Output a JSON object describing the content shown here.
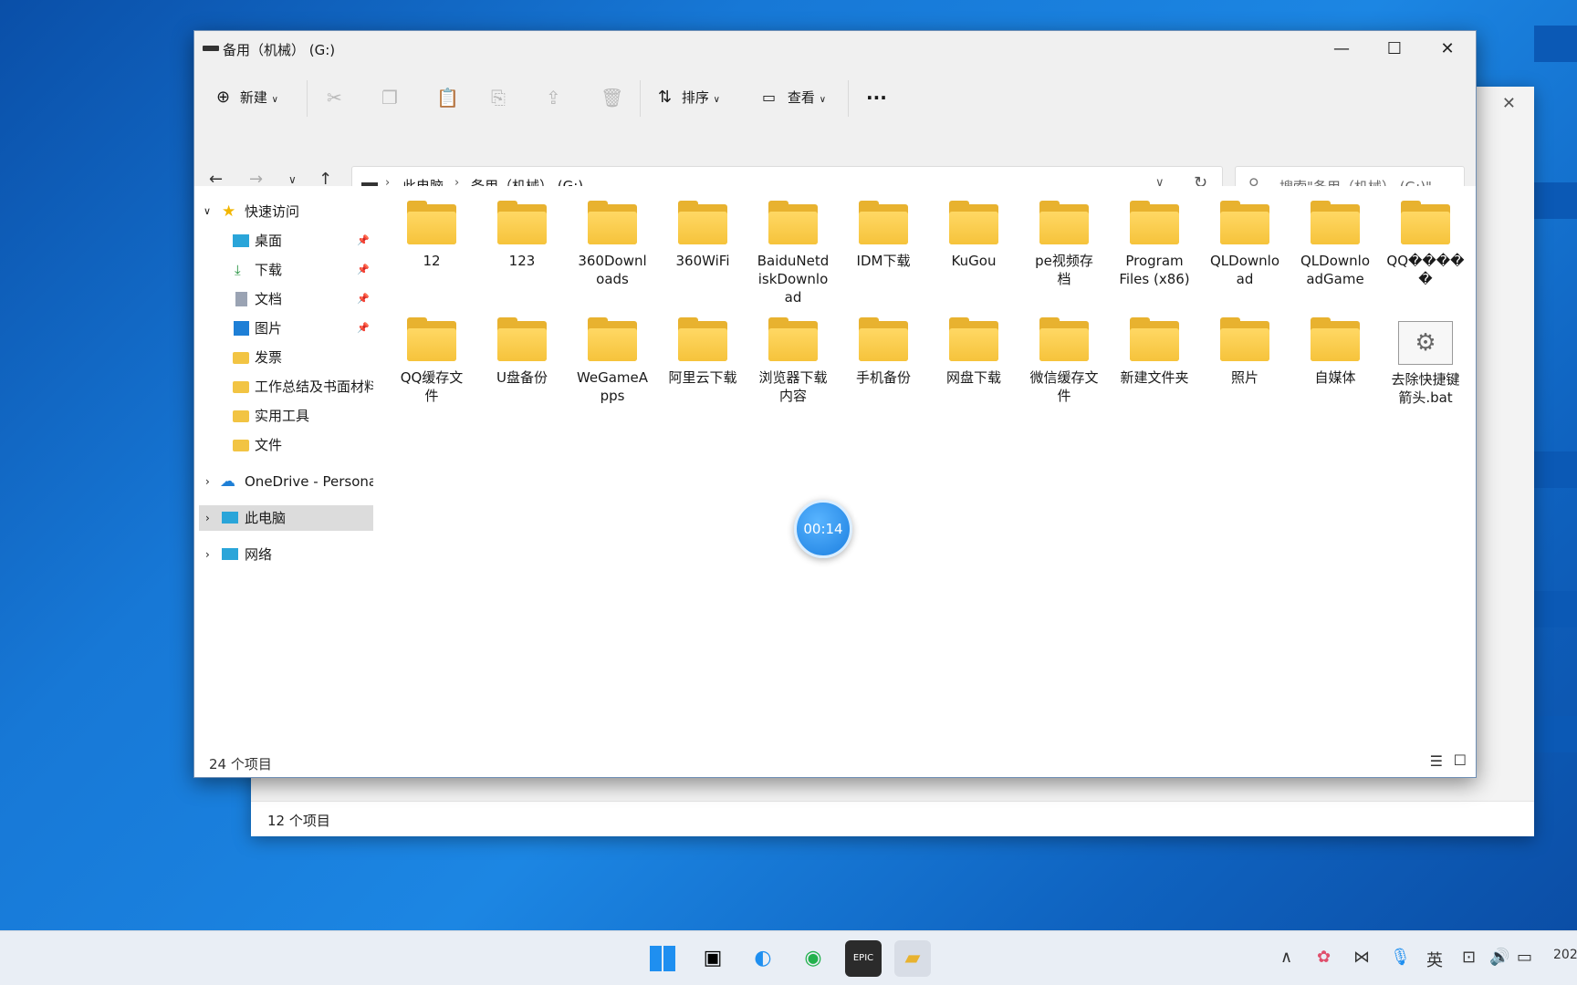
{
  "window": {
    "title": "备用（机械） (G:)",
    "min": "—",
    "max": "☐",
    "close": "✕"
  },
  "toolbar": {
    "new_label": "新建",
    "sort_label": "排序",
    "view_label": "查看",
    "more_label": "···"
  },
  "address": {
    "crumb1": "此电脑",
    "crumb2": "备用（机械） (G:)",
    "search_placeholder": "搜索\"备用（机械） (G:)\""
  },
  "sidebar": {
    "quick_access": "快速访问",
    "items": [
      {
        "label": "桌面",
        "pinned": true
      },
      {
        "label": "下载",
        "pinned": true
      },
      {
        "label": "文档",
        "pinned": true
      },
      {
        "label": "图片",
        "pinned": true
      },
      {
        "label": "发票",
        "pinned": false
      },
      {
        "label": "工作总结及书面材料",
        "pinned": false
      },
      {
        "label": "实用工具",
        "pinned": false
      },
      {
        "label": "文件",
        "pinned": false
      }
    ],
    "onedrive": "OneDrive - Personal",
    "this_pc": "此电脑",
    "network": "网络"
  },
  "files": [
    "12",
    "123",
    "360Downloads",
    "360WiFi",
    "BaiduNetdiskDownload",
    "IDM下载",
    "KuGou",
    "pe视频存档",
    "Program Files (x86)",
    "QLDownload",
    "QLDownloadGame",
    "QQ����",
    "QQ缓存文件",
    "U盘备份",
    "WeGameApps",
    "阿里云下载",
    "浏览器下载内容",
    "手机备份",
    "网盘下载",
    "微信缓存文件",
    "新建文件夹",
    "照片",
    "自媒体",
    "去除快捷键箭头.bat"
  ],
  "file_lines": [
    [
      "12"
    ],
    [
      "123"
    ],
    [
      "360Downl",
      "oads"
    ],
    [
      "360WiFi"
    ],
    [
      "BaiduNetd",
      "iskDownlo",
      "ad"
    ],
    [
      "IDM下载"
    ],
    [
      "KuGou"
    ],
    [
      "pe视频存",
      "档"
    ],
    [
      "Program",
      "Files (x86)"
    ],
    [
      "QLDownlo",
      "ad"
    ],
    [
      "QLDownlo",
      "adGame"
    ],
    [
      "QQ����",
      "�"
    ],
    [
      "QQ缓存文",
      "件"
    ],
    [
      "U盘备份"
    ],
    [
      "WeGameA",
      "pps"
    ],
    [
      "阿里云下载"
    ],
    [
      "浏览器下载",
      "内容"
    ],
    [
      "手机备份"
    ],
    [
      "网盘下载"
    ],
    [
      "微信缓存文",
      "件"
    ],
    [
      "新建文件夹"
    ],
    [
      "照片"
    ],
    [
      "自媒体"
    ],
    [
      "去除快捷键",
      "箭头.bat"
    ]
  ],
  "status": {
    "count": "24 个项目",
    "bg_count": "12 个项目"
  },
  "timer": "00:14",
  "taskbar": {
    "ime": "英",
    "clock_partial": "202"
  },
  "colors": {
    "desktop": "#1c86e3",
    "folder": "#f6c33b",
    "selection": "#dcdcdc"
  }
}
